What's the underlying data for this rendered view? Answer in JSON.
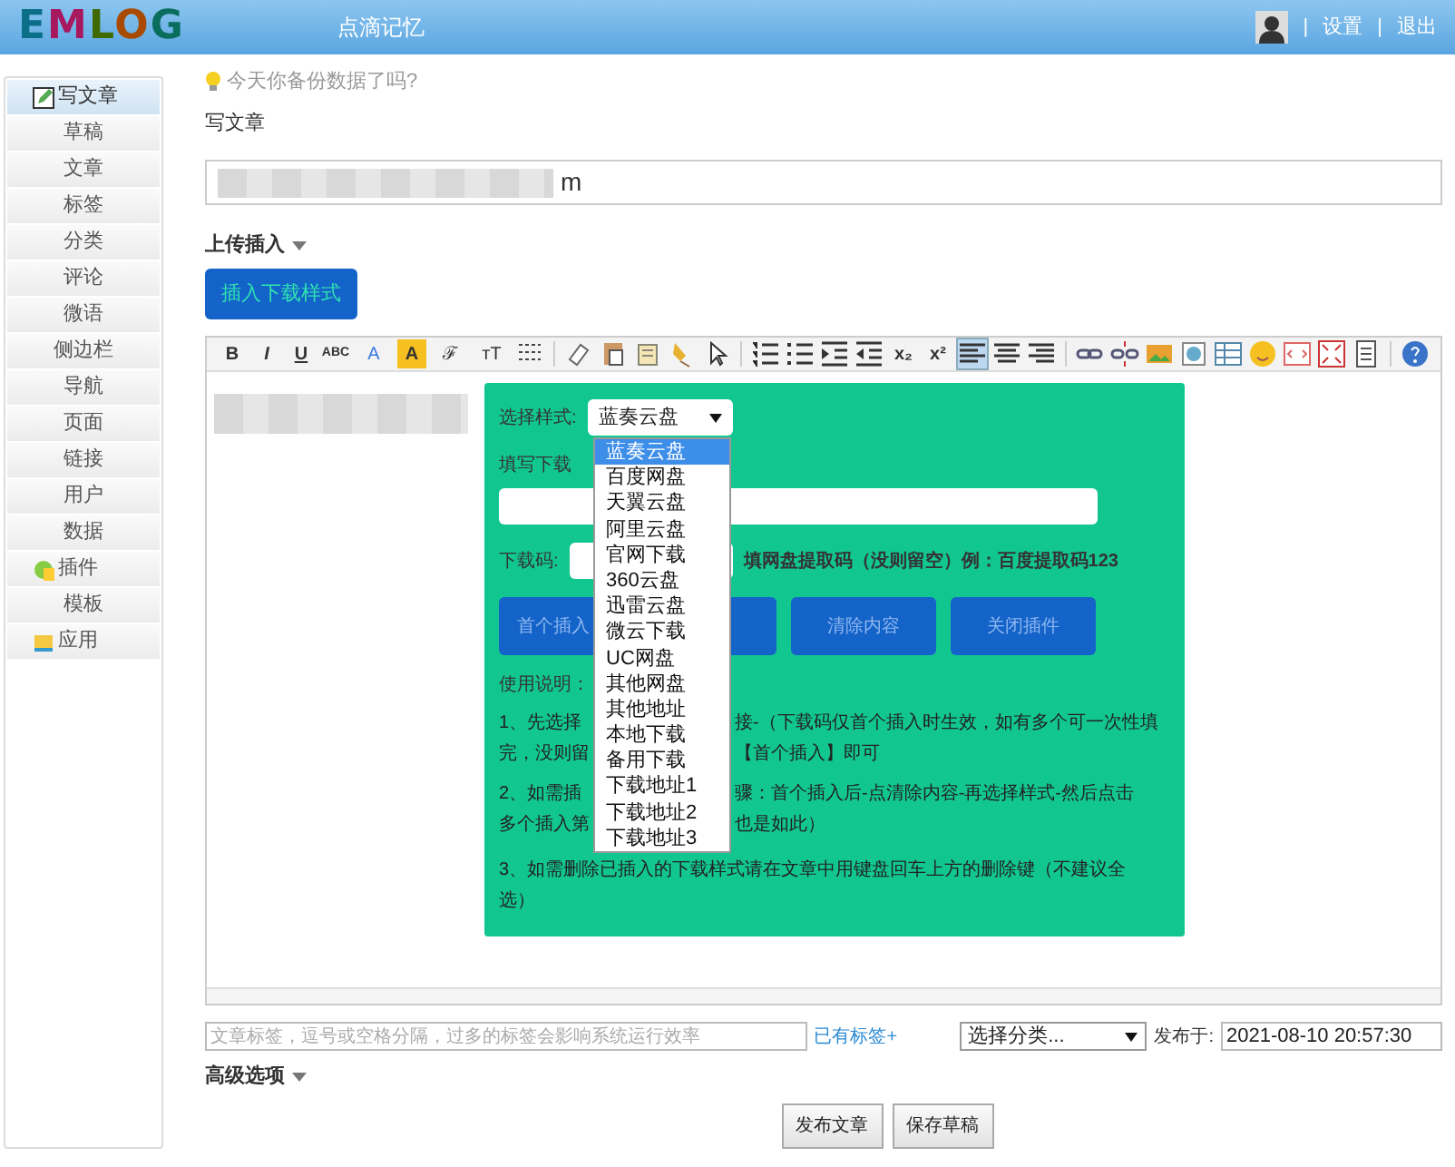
{
  "header": {
    "logo": "EMLOG",
    "site_name": "点滴记忆",
    "links": [
      "设置",
      "退出"
    ],
    "separator": "|"
  },
  "sidebar": {
    "items": [
      {
        "label": "写文章",
        "selected": true,
        "kind": "write"
      },
      {
        "label": "草稿",
        "selected": false,
        "kind": "plain"
      },
      {
        "label": "文章",
        "selected": false,
        "kind": "plain"
      },
      {
        "label": "标签",
        "selected": false,
        "kind": "plain"
      },
      {
        "label": "分类",
        "selected": false,
        "kind": "plain"
      },
      {
        "label": "评论",
        "selected": false,
        "kind": "plain"
      },
      {
        "label": "微语",
        "selected": false,
        "kind": "plain"
      },
      {
        "label": "侧边栏",
        "selected": false,
        "kind": "plain"
      },
      {
        "label": "导航",
        "selected": false,
        "kind": "plain"
      },
      {
        "label": "页面",
        "selected": false,
        "kind": "plain"
      },
      {
        "label": "链接",
        "selected": false,
        "kind": "plain"
      },
      {
        "label": "用户",
        "selected": false,
        "kind": "plain"
      },
      {
        "label": "数据",
        "selected": false,
        "kind": "plain"
      },
      {
        "label": "插件",
        "selected": false,
        "kind": "plugin"
      },
      {
        "label": "模板",
        "selected": false,
        "kind": "plain"
      },
      {
        "label": "应用",
        "selected": false,
        "kind": "app"
      }
    ]
  },
  "tip": "今天你备份数据了吗?",
  "page_title": "写文章",
  "title_field": {
    "value": "m"
  },
  "upload_toggle": "上传插入",
  "insert_button": "插入下载样式",
  "toolbar": [
    {
      "kind": "bold",
      "label": "B"
    },
    {
      "kind": "italic",
      "label": "I"
    },
    {
      "kind": "underline",
      "label": "U"
    },
    {
      "kind": "strike",
      "label": "ABC"
    },
    {
      "kind": "color",
      "label": "A"
    },
    {
      "kind": "highlight",
      "label": "A"
    },
    {
      "kind": "font",
      "label": "ℱ"
    },
    {
      "kind": "size",
      "label": "тT"
    },
    {
      "kind": "hr"
    },
    {
      "kind": "sep"
    },
    {
      "kind": "eraser"
    },
    {
      "kind": "paste"
    },
    {
      "kind": "pasteword"
    },
    {
      "kind": "brush"
    },
    {
      "kind": "pointer"
    },
    {
      "kind": "sep"
    },
    {
      "kind": "numbers"
    },
    {
      "kind": "bullets"
    },
    {
      "kind": "indent"
    },
    {
      "kind": "outdent"
    },
    {
      "kind": "sub",
      "label": "x₂"
    },
    {
      "kind": "sup",
      "label": "x²"
    },
    {
      "kind": "align-left",
      "selected": true
    },
    {
      "kind": "align-center",
      "selected": false
    },
    {
      "kind": "align-right",
      "selected": false
    },
    {
      "kind": "sep"
    },
    {
      "kind": "link"
    },
    {
      "kind": "unlink"
    },
    {
      "kind": "image"
    },
    {
      "kind": "flash"
    },
    {
      "kind": "table"
    },
    {
      "kind": "emoji"
    },
    {
      "kind": "code"
    },
    {
      "kind": "fullscreen"
    },
    {
      "kind": "page"
    },
    {
      "kind": "sep"
    },
    {
      "kind": "help"
    }
  ],
  "plugin_panel": {
    "style_label": "选择样式:",
    "style_select": "蓝奏云盘",
    "style_options": [
      {
        "label": "蓝奏云盘",
        "selected": true
      },
      {
        "label": "百度网盘",
        "selected": false
      },
      {
        "label": "天翼云盘",
        "selected": false
      },
      {
        "label": "阿里云盘",
        "selected": false
      },
      {
        "label": "官网下载",
        "selected": false
      },
      {
        "label": "360云盘",
        "selected": false
      },
      {
        "label": "迅雷云盘",
        "selected": false
      },
      {
        "label": "微云下载",
        "selected": false
      },
      {
        "label": "UC网盘",
        "selected": false
      },
      {
        "label": "其他网盘",
        "selected": false
      },
      {
        "label": "其他地址",
        "selected": false
      },
      {
        "label": "本地下载",
        "selected": false
      },
      {
        "label": "备用下载",
        "selected": false
      },
      {
        "label": "下载地址1",
        "selected": false
      },
      {
        "label": "下载地址2",
        "selected": false
      },
      {
        "label": "下载地址3",
        "selected": false
      }
    ],
    "link_label": "填写下载",
    "code_label": "下载码:",
    "code_hint": "填网盘提取码（没则留空）例：百度提取码123",
    "buttons": [
      {
        "kind": "text",
        "label": "首个插入"
      },
      {
        "kind": "covered"
      },
      {
        "kind": "text",
        "label": "清除内容"
      },
      {
        "kind": "text",
        "label": "关闭插件"
      }
    ],
    "usage_title": "使用说明：",
    "instructions": [
      [
        {
          "left": "1、先选择",
          "right": "接-（下载码仅首个插入时生效，如有多个可一次性填"
        },
        {
          "left": "完，没则留",
          "right": "【首个插入】即可"
        }
      ],
      [
        {
          "left": "2、如需插",
          "right": "骤：首个插入后-点清除内容-再选择样式-然后点击"
        },
        {
          "left": "多个插入第",
          "right": "也是如此）"
        }
      ],
      [
        {
          "left": "3、如需删除已插入的下载样式请在文章中用键盘回车上方的删除键（不建议全"
        },
        {
          "left": "选）"
        }
      ]
    ]
  },
  "tags_field": {
    "placeholder": "文章标签，逗号或空格分隔，过多的标签会影响系统运行效率"
  },
  "existing_tags_link": "已有标签+",
  "category_select": "选择分类...",
  "publish_label": "发布于:",
  "publish_time": "2021-08-10 20:57:30",
  "advanced_toggle": "高级选项",
  "actions": [
    "发布文章",
    "保存草稿"
  ]
}
